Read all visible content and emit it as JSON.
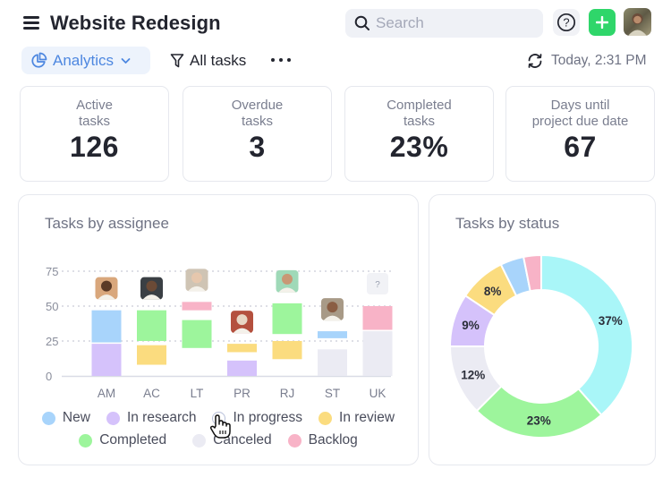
{
  "header": {
    "title": "Website Redesign",
    "search_placeholder": "Search",
    "help_label": "?",
    "add_label": "+"
  },
  "toolbar": {
    "view_label": "Analytics",
    "filter_label": "All tasks",
    "refresh_label": "Today, 2:31 PM"
  },
  "kpis": [
    {
      "label_line1": "Active",
      "label_line2": "tasks",
      "value": "126"
    },
    {
      "label_line1": "Overdue",
      "label_line2": "tasks",
      "value": "3"
    },
    {
      "label_line1": "Completed",
      "label_line2": "tasks",
      "value": "23%"
    },
    {
      "label_line1": "Days until",
      "label_line2": "project due date",
      "value": "67"
    }
  ],
  "colors": {
    "New": "#a8d4fb",
    "In research": "#d5c2fb",
    "In progress": "#a9f6f8",
    "In review": "#fbdc7f",
    "Completed": "#9df59c",
    "Canceled": "#ebebf3",
    "Backlog": "#f8b3c7",
    "accent": "#4d87e0",
    "add_button": "#2fd66a"
  },
  "chart_data": [
    {
      "type": "bar",
      "title": "Tasks by assignee",
      "xlabel": "",
      "ylabel": "",
      "ylim": [
        0,
        75
      ],
      "yticks": [
        0,
        25,
        50,
        75
      ],
      "grid": true,
      "categories": [
        "AM",
        "AC",
        "LT",
        "PR",
        "RJ",
        "ST",
        "UK"
      ],
      "legend": {
        "position": "bottom",
        "entries": [
          "New",
          "In research",
          "In progress",
          "In review",
          "Completed",
          "Canceled",
          "Backlog"
        ],
        "hidden": [
          "In progress"
        ]
      },
      "bars": [
        {
          "category": "AM",
          "segments": [
            {
              "series": "In research",
              "from": 0,
              "to": 23
            },
            {
              "series": "New",
              "from": 24,
              "to": 47
            }
          ]
        },
        {
          "category": "AC",
          "segments": [
            {
              "series": "In review",
              "from": 8,
              "to": 22
            },
            {
              "series": "Completed",
              "from": 25,
              "to": 47
            }
          ]
        },
        {
          "category": "LT",
          "segments": [
            {
              "series": "Completed",
              "from": 20,
              "to": 40
            },
            {
              "series": "Backlog",
              "from": 47,
              "to": 53
            }
          ]
        },
        {
          "category": "PR",
          "segments": [
            {
              "series": "In research",
              "from": 0,
              "to": 11
            },
            {
              "series": "In review",
              "from": 17,
              "to": 23
            }
          ]
        },
        {
          "category": "RJ",
          "segments": [
            {
              "series": "In review",
              "from": 12,
              "to": 25
            },
            {
              "series": "Completed",
              "from": 30,
              "to": 52
            }
          ]
        },
        {
          "category": "ST",
          "segments": [
            {
              "series": "Canceled",
              "from": 0,
              "to": 19
            },
            {
              "series": "New",
              "from": 27,
              "to": 32
            }
          ]
        },
        {
          "category": "UK",
          "segments": [
            {
              "series": "Canceled",
              "from": 0,
              "to": 32
            },
            {
              "series": "Backlog",
              "from": 33,
              "to": 50
            }
          ]
        }
      ],
      "avatars": [
        {
          "category": "AM",
          "kind": "photo",
          "bg": "#d9a77c",
          "skin": "#5b3a26"
        },
        {
          "category": "AC",
          "kind": "photo",
          "bg": "#3a3f44",
          "skin": "#6b4a36"
        },
        {
          "category": "LT",
          "kind": "photo",
          "bg": "#cfc4b4",
          "skin": "#e6c7ad"
        },
        {
          "category": "PR",
          "kind": "photo",
          "bg": "#b4503e",
          "skin": "#e8d6c4"
        },
        {
          "category": "RJ",
          "kind": "photo",
          "bg": "#9fd9b8",
          "skin": "#c99775"
        },
        {
          "category": "ST",
          "kind": "photo",
          "bg": "#a89a87",
          "skin": "#8a5e44"
        },
        {
          "category": "UK",
          "kind": "unknown",
          "label": "?"
        }
      ]
    },
    {
      "type": "pie",
      "title": "Tasks by status",
      "donut": true,
      "slices": [
        {
          "label": "In progress",
          "value": 37,
          "display": "37%"
        },
        {
          "label": "Completed",
          "value": 23,
          "display": "23%"
        },
        {
          "label": "Canceled",
          "value": 12,
          "display": "12%"
        },
        {
          "label": "In research",
          "value": 9,
          "display": "9%"
        },
        {
          "label": "In review",
          "value": 8,
          "display": "8%"
        },
        {
          "label": "New",
          "value": 4,
          "display": ""
        },
        {
          "label": "Backlog",
          "value": 3,
          "display": ""
        }
      ]
    }
  ]
}
